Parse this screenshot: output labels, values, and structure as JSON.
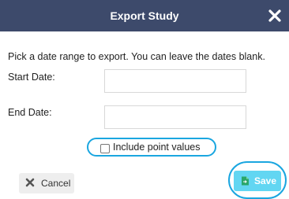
{
  "dialog": {
    "title": "Export Study",
    "instructions": "Pick a date range to export. You can leave the dates blank.",
    "start_label": "Start Date:",
    "start_value": "",
    "end_label": "End Date:",
    "end_value": "",
    "include_points_label": "Include point values",
    "include_points_checked": false,
    "cancel_label": "Cancel",
    "save_label": "Save"
  },
  "colors": {
    "header": "#3d4a6b",
    "save_button": "#62d6f2",
    "highlight_ring": "#1aa6e0",
    "cancel_button": "#eeeeee"
  },
  "icons": {
    "close": "close-icon",
    "cancel": "x-icon",
    "save": "file-export-icon"
  }
}
